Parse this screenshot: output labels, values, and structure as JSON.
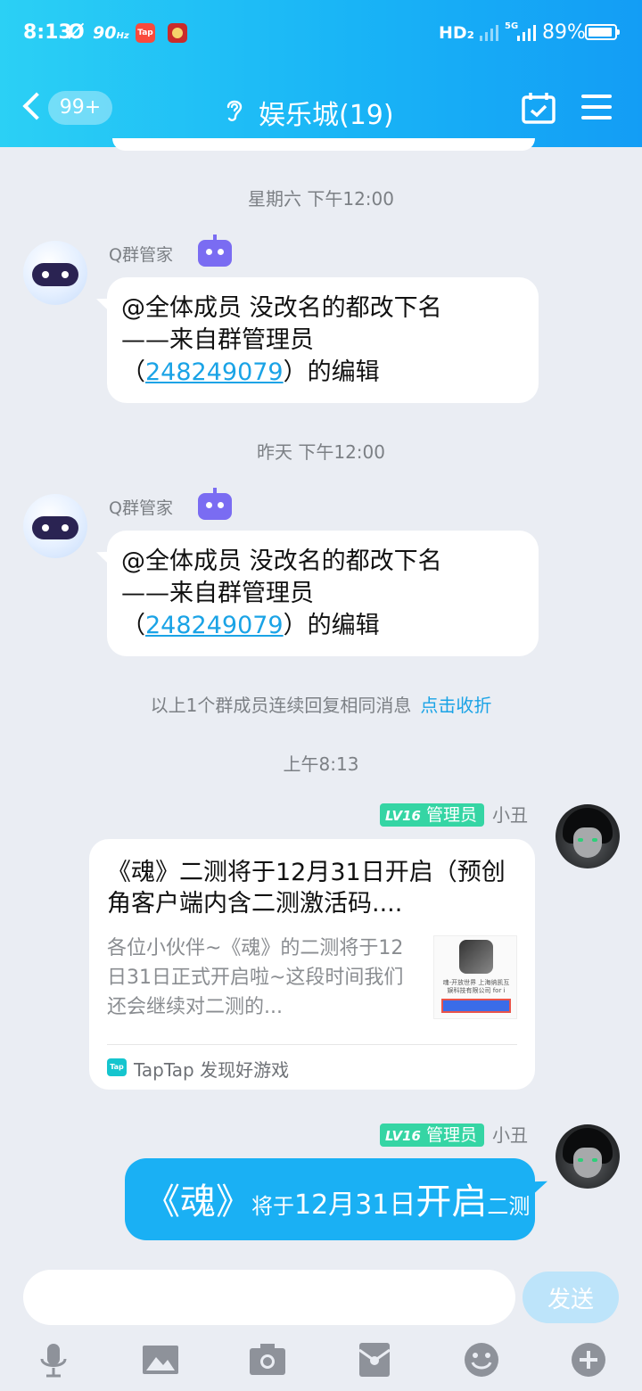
{
  "status_bar": {
    "time": "8:13",
    "alarm_glyph": "Ø",
    "refresh_rate": "90",
    "refresh_unit": "Hz",
    "tap_icon_text": "Tap",
    "network": "HD₂",
    "mobile_5g": "5G",
    "battery": "89%",
    "battery_level": 0.89
  },
  "header": {
    "back_badge": "99+",
    "title": "娱乐城(19)",
    "icons": [
      "back-chevron-icon",
      "ear-icon",
      "calendar-check-icon",
      "menu-icon"
    ]
  },
  "messages": {
    "ts1": "星期六 下午12:00",
    "ts2": "昨天 下午12:00",
    "ts3": "上午8:13",
    "bot_name": "Q群管家",
    "bot_line1": "@全体成员 没改名的都改下名",
    "bot_line2": "——来自群管理员",
    "bot_paren_open": "（",
    "bot_qq": "248249079",
    "bot_paren_close": "）的编辑",
    "fold_text": "以上1个群成员连续回复相同消息",
    "fold_link": "点击收折",
    "lv_label": "LV16",
    "role": "管理员",
    "nick": "小丑"
  },
  "card": {
    "title": "《魂》二测将于12月31日开启（预创角客户端内含二测激活码....",
    "desc": "各位小伙伴~《魂》的二测将于12日31日正式开启啦~这段时间我们还会继续对二测的...",
    "thumb_text": "魂-开放世界 上海纳凯互娱科技有限公司 for i",
    "source_icon": "Tap",
    "source": "TapTap 发现好游戏"
  },
  "styled_message": {
    "seg1": "《魂》",
    "seg2": "将于",
    "seg3": "12月31日",
    "seg4": "开启",
    "seg5": "二测"
  },
  "input": {
    "placeholder": "",
    "send": "发送",
    "tools": [
      "microphone-icon",
      "image-icon",
      "camera-icon",
      "red-packet-icon",
      "emoji-icon",
      "plus-icon"
    ]
  },
  "colors": {
    "header_start": "#2bd0f5",
    "header_end": "#139df5",
    "link": "#1aa3e6",
    "admin_tag": "#35d5a4",
    "bubble_blue": "#1ab0f4",
    "background": "#eaedf3"
  }
}
